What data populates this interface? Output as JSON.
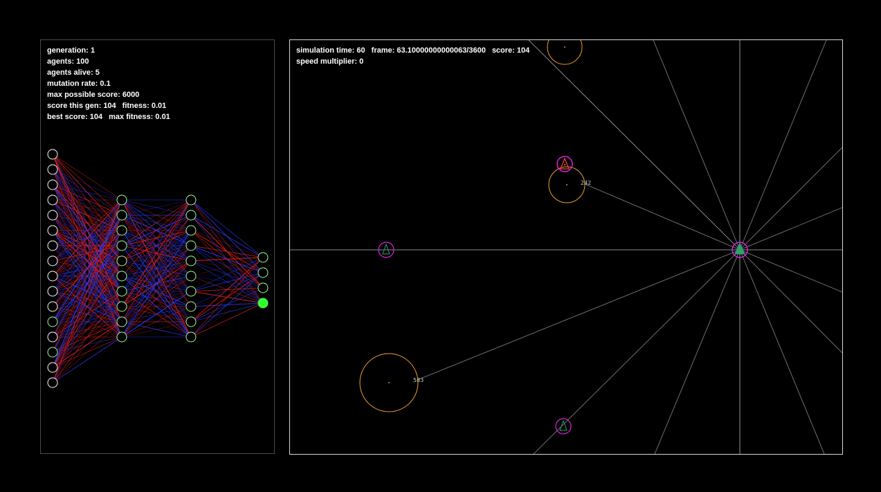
{
  "left_stats": {
    "generation_label": "generation:",
    "generation": "1",
    "agents_label": "agents:",
    "agents": "100",
    "alive_label": "agents alive:",
    "alive": "5",
    "mutation_label": "mutation rate:",
    "mutation": "0.1",
    "max_score_label": "max possible score:",
    "max_score": "6000",
    "score_gen_label": "score this gen:",
    "score_gen": "104",
    "fitness_label": "fitness:",
    "fitness": "0.01",
    "best_label": "best score:",
    "best": "104",
    "max_fitness_label": "max fitness:",
    "max_fitness": "0.01"
  },
  "sim_stats": {
    "time_label": "simulation time:",
    "time": "60",
    "frame_label": "frame:",
    "frame": "63.10000000000063/3600",
    "score_label": "score:",
    "score": "104",
    "speed_label": "speed multiplier:",
    "speed": "0"
  },
  "network": {
    "layers": [
      {
        "nodes": 16,
        "active": [
          11,
          13
        ]
      },
      {
        "nodes": 10,
        "active": []
      },
      {
        "nodes": 10,
        "active": []
      },
      {
        "nodes": 4,
        "active": [],
        "filled": [
          3
        ]
      }
    ]
  },
  "world": {
    "food_labels": [
      "242",
      "583"
    ]
  },
  "colors": {
    "background": "#000000",
    "text": "#ffffff",
    "weight_positive": "#e02020",
    "weight_negative": "#2a3cff",
    "node_active": "#33ff33",
    "food": "#f0a030",
    "agent_ring": "#e020e0",
    "agent_body": "#30a070",
    "sensor_ray": "#9a9a9a"
  }
}
